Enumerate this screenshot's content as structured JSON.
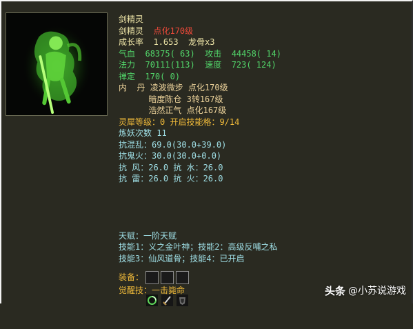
{
  "pet": {
    "title": "剑精灵",
    "name": "剑精灵",
    "enhance": "点化170级",
    "growth_label": "成长率",
    "growth_value": "1.653",
    "bone": "龙骨x3",
    "hp_label": "气血",
    "hp_value": "68375( 63)",
    "atk_label": "攻击",
    "atk_value": "44458( 14)",
    "mp_label": "法力",
    "mp_value": "70111(113)",
    "spd_label": "速度",
    "spd_value": "723( 124)",
    "zen_label": "禅定",
    "zen_value": "170( 0)",
    "neidan_label": "内  丹",
    "neidan": [
      {
        "name": "凌波微步",
        "level": "点化170级"
      },
      {
        "name": "暗度陈仓",
        "level": "3转167级"
      },
      {
        "name": "浩然正气",
        "level": "点化167级"
      }
    ],
    "lingxi": "灵犀等级：0 开启技能格：9/14",
    "refine": "炼妖次数 11",
    "resist_chaos": "抗混乱：69.0(30.0+39.0)",
    "resist_ghostfire": "抗鬼火：30.0(30.0+0.0)",
    "resist_wind": "抗  风：26.0 抗  水：26.0",
    "resist_thunder": "抗  雷：26.0 抗  火：26.0",
    "talent": "天赋：一阶天赋",
    "skills_row1": "技能1：义之金叶神；技能2：高级反哺之私",
    "skills_row2": "技能3：仙风道骨；技能4：已开启",
    "equip_label": "装备：",
    "equip_icons": [
      "swirl-rune-icon",
      "sword-icon",
      "dark-armor-icon"
    ],
    "awaken": "觉醒技：一击毙命"
  },
  "watermark": {
    "brand": "头条",
    "account": "@小苏说游戏"
  },
  "colors": {
    "background": "#2a2a21",
    "title": "#efe6a8",
    "red": "#f04a3a",
    "green": "#52d66a",
    "tan": "#ecd29a",
    "cyan": "#9fdfe6",
    "gold": "#f1bb3a"
  }
}
